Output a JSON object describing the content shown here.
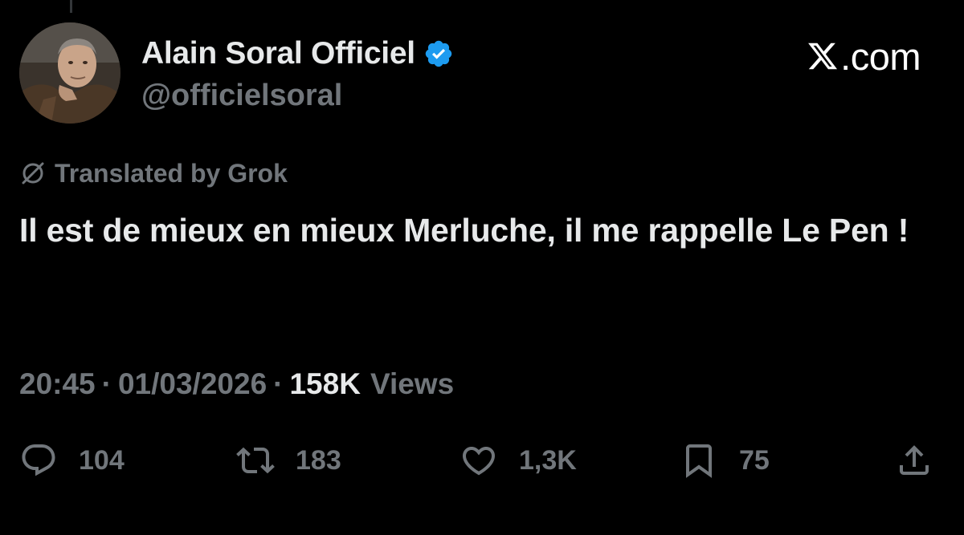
{
  "author": {
    "display_name": "Alain Soral Officiel",
    "handle": "@officielsoral",
    "verified": true,
    "avatar_icon": "avatar-photo"
  },
  "site": {
    "label": ".com",
    "logo_icon": "x-logo-icon"
  },
  "translation": {
    "label": "Translated by Grok",
    "icon": "grok-icon"
  },
  "tweet": {
    "text": "Il est de mieux en mieux Merluche, il me rappelle Le Pen !"
  },
  "meta": {
    "time": "20:45",
    "separator": "·",
    "date": "01/03/2026",
    "views_count": "158K",
    "views_label": "Views"
  },
  "actions": {
    "reply_count": "104",
    "repost_count": "183",
    "like_count": "1,3K",
    "bookmark_count": "75"
  },
  "colors": {
    "background": "#000000",
    "primary_text": "#e7e9ea",
    "secondary_text": "#71767b",
    "verified_blue": "#1d9bf0"
  }
}
